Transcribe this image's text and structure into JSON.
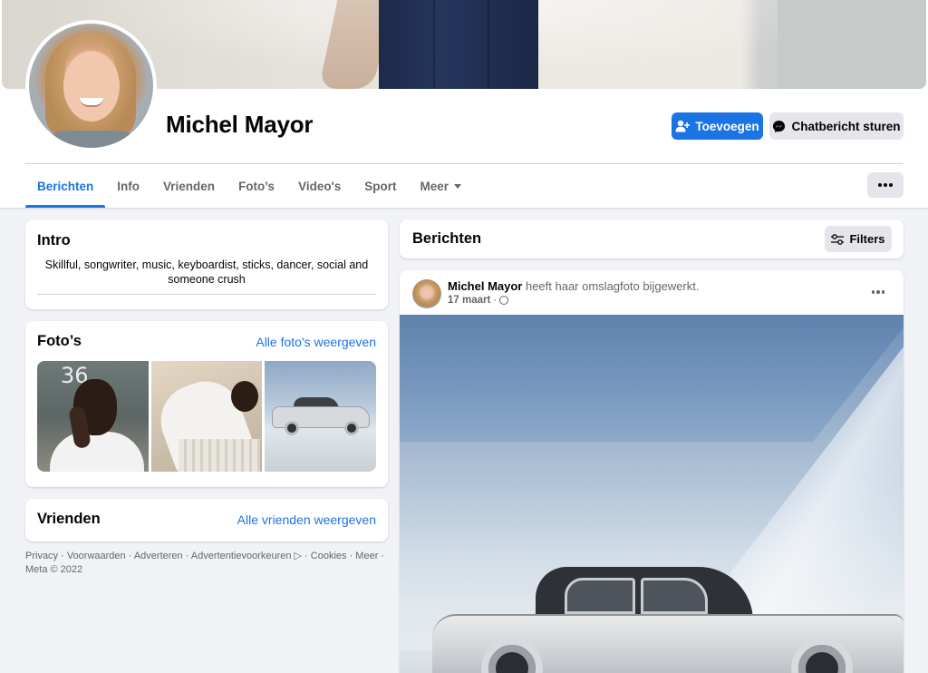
{
  "profile": {
    "name": "Michel Mayor",
    "add_button": "Toevoegen",
    "chat_button": "Chatbericht sturen"
  },
  "tabs": [
    {
      "label": "Berichten",
      "active": true
    },
    {
      "label": "Info"
    },
    {
      "label": "Vrienden"
    },
    {
      "label": "Foto’s"
    },
    {
      "label": "Video's"
    },
    {
      "label": "Sport"
    },
    {
      "label": "Meer"
    }
  ],
  "intro": {
    "title": "Intro",
    "bio": "Skillful, songwriter, music, keyboardist, sticks, dancer, social and someone crush"
  },
  "photos": {
    "title": "Foto’s",
    "link": "Alle foto's weergeven",
    "clock": "36"
  },
  "friends": {
    "title": "Vrienden",
    "link": "Alle vrienden weergeven"
  },
  "footer": {
    "line": "Privacy · Voorwaarden · Adverteren · Advertentievoorkeuren ▷ · Cookies · Meer ·",
    "copyright": "Meta © 2022"
  },
  "posts": {
    "title": "Berichten",
    "filter_button": "Filters"
  },
  "post": {
    "author": "Michel Mayor",
    "action": " heeft haar omslagfoto bijgewerkt.",
    "date": "17 maart",
    "separator": " · "
  },
  "colors": {
    "accent": "#1b74e4",
    "secondary_button": "#e4e6eb",
    "page_background": "#f0f2f5",
    "muted_text": "#65676b"
  },
  "icons": {
    "add_button": "add-friend-icon",
    "chat_button": "messenger-icon",
    "tab_more": "caret-down-icon",
    "profile_more": "more-dots-icon",
    "filters": "sliders-icon",
    "audience": "globe-icon"
  }
}
